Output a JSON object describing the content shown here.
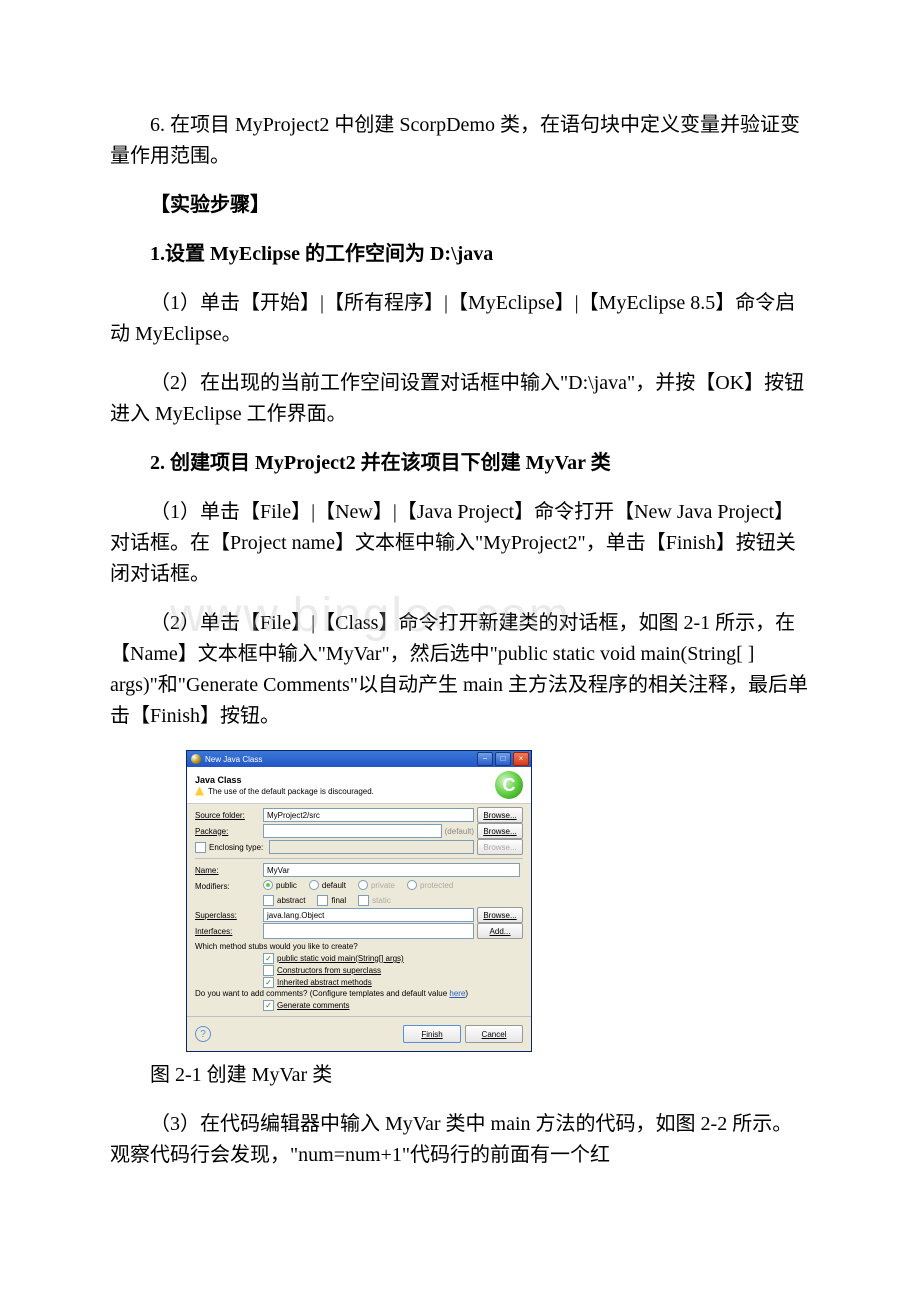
{
  "paragraphs": {
    "p1": "6. 在项目 MyProject2 中创建 ScorpDemo 类，在语句块中定义变量并验证变量作用范围。",
    "h1": "【实验步骤】",
    "h2": "1.设置 MyEclipse 的工作空间为 D:\\java",
    "p2": "（1）单击【开始】|【所有程序】|【MyEclipse】|【MyEclipse 8.5】命令启动 MyEclipse。",
    "p3": "（2）在出现的当前工作空间设置对话框中输入\"D:\\java\"，并按【OK】按钮进入 MyEclipse 工作界面。",
    "h3": "2. 创建项目 MyProject2 并在该项目下创建 MyVar 类",
    "p4": "（1）单击【File】|【New】|【Java Project】命令打开【New Java Project】对话框。在【Project name】文本框中输入\"MyProject2\"，单击【Finish】按钮关闭对话框。",
    "p5": "（2）单击【File】|【Class】命令打开新建类的对话框，如图 2-1 所示，在【Name】文本框中输入\"MyVar\"，然后选中\"public static void main(String[ ] args)\"和\"Generate Comments\"以自动产生 main 主方法及程序的相关注释，最后单击【Finish】按钮。",
    "caption": "图 2-1 创建 MyVar 类",
    "p6": "（3）在代码编辑器中输入 MyVar 类中 main 方法的代码，如图 2-2 所示。观察代码行会发现，\"num=num+1\"代码行的前面有一个红"
  },
  "dialog": {
    "title": "New Java Class",
    "bannerTitle": "Java Class",
    "bannerMsg": "The use of the default package is discouraged.",
    "cIcon": "C",
    "labels": {
      "sourceFolder": "Source folder:",
      "package": "Package:",
      "enclosingType": "Enclosing type:",
      "name": "Name:",
      "modifiers": "Modifiers:",
      "superclass": "Superclass:",
      "interfaces": "Interfaces:"
    },
    "values": {
      "sourceFolder": "MyProject2/src",
      "package": "",
      "packageDefault": "(default)",
      "enclosingType": "",
      "name": "MyVar",
      "superclass": "java.lang.Object"
    },
    "modifiers": {
      "public": "public",
      "default": "default",
      "private": "private",
      "protected": "protected",
      "abstract": "abstract",
      "final": "final",
      "static": "static"
    },
    "buttons": {
      "browse": "Browse...",
      "add": "Add...",
      "finish": "Finish",
      "cancel": "Cancel"
    },
    "stubs": {
      "q1": "Which method stubs would you like to create?",
      "main": "public static void main(String[] args)",
      "constructors": "Constructors from superclass",
      "inherited": "Inherited abstract methods",
      "q2a": "Do you want to add comments? (Configure templates and default value ",
      "q2link": "here",
      "q2b": ")",
      "generate": "Generate comments"
    },
    "help": "?",
    "winbtns": {
      "min": "−",
      "max": "□",
      "close": "×"
    }
  },
  "watermark": "www.bingloc.com"
}
